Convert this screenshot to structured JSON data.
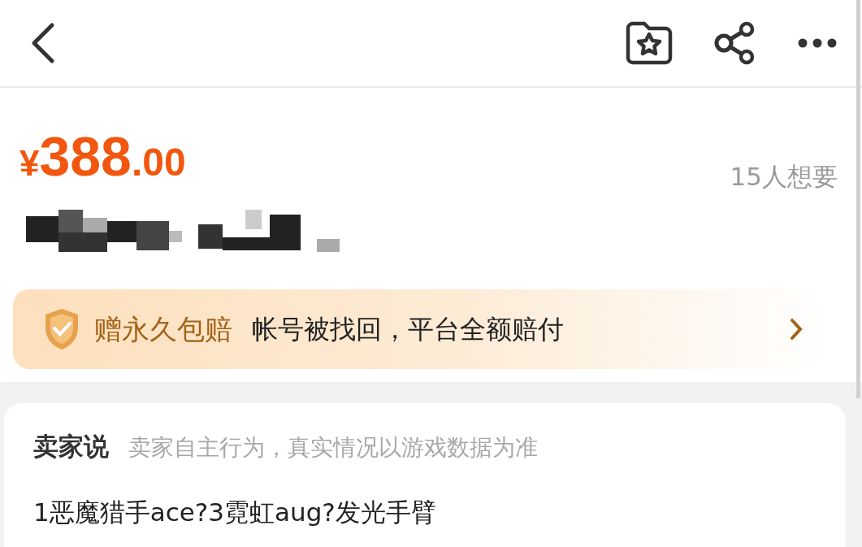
{
  "header": {
    "actions": [
      {
        "kind": "favorite"
      },
      {
        "kind": "share"
      },
      {
        "kind": "more"
      }
    ]
  },
  "price": {
    "currency": "¥",
    "integer": "388",
    "decimal": ".00"
  },
  "wants": "15人想要",
  "guarantee": {
    "title": "赠永久包赔",
    "text": "帐号被找回，平台全额赔付"
  },
  "seller_says": {
    "title": "卖家说",
    "note": "卖家自主行为，真实情况以游戏数据为准",
    "text": "1恶魔猎手ace?3霓虹aug?发光手臂"
  }
}
